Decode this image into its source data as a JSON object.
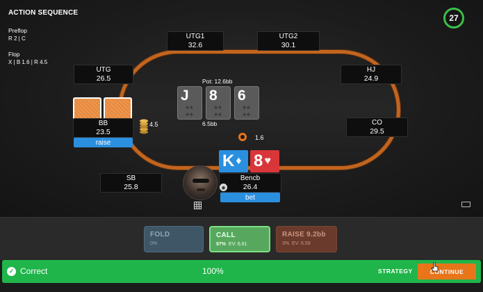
{
  "action_sequence": {
    "title": "ACTION SEQUENCE",
    "preflop": {
      "street": "Preflop",
      "actions": "R 2  |  C"
    },
    "flop": {
      "street": "Flop",
      "actions": "X  |  B 1.6  |  R 4.5"
    }
  },
  "timer": "27",
  "seats": {
    "utg1": {
      "name": "UTG1",
      "stack": "32.6"
    },
    "utg2": {
      "name": "UTG2",
      "stack": "30.1"
    },
    "utg": {
      "name": "UTG",
      "stack": "26.5"
    },
    "hj": {
      "name": "HJ",
      "stack": "24.9"
    },
    "bb": {
      "name": "BB",
      "stack": "23.5",
      "action": "raise",
      "bet": "4.5"
    },
    "co": {
      "name": "CO",
      "stack": "29.5"
    },
    "sb": {
      "name": "SB",
      "stack": "25.8"
    },
    "hero": {
      "name": "Bencb",
      "stack": "26.4",
      "action": "bet",
      "bet": "1.6"
    }
  },
  "pot": {
    "label": "Pot: 12.6bb",
    "amount": "6.5bb"
  },
  "board": [
    {
      "rank": "J",
      "suit": "spade"
    },
    {
      "rank": "8",
      "suit": "spade"
    },
    {
      "rank": "6",
      "suit": "spade"
    }
  ],
  "hero_cards": [
    {
      "rank": "K",
      "suit": "♦",
      "color": "#2b8fe0"
    },
    {
      "rank": "8",
      "suit": "♥",
      "color": "#d9363a"
    }
  ],
  "actions": {
    "fold": {
      "label": "FOLD",
      "freq": "0%"
    },
    "call": {
      "label": "CALL",
      "freq": "97%",
      "ev": "EV: 6.61"
    },
    "raise": {
      "label": "RAISE 9.2bb",
      "freq": "3%",
      "ev": "EV: 6.59"
    }
  },
  "result": {
    "status": "Correct",
    "score": "100%",
    "strategy_label": "STRATEGY",
    "continue_label": "CONTINUE"
  },
  "colors": {
    "rail": "#c2651f",
    "success": "#1fb54a",
    "continue": "#e8751a",
    "action_tag": "#2b8fe0"
  }
}
